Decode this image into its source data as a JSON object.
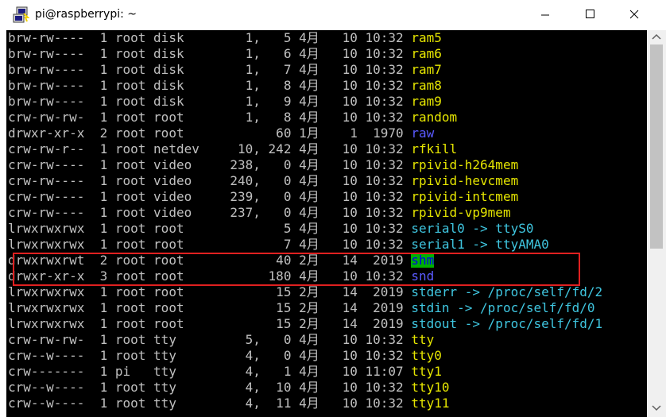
{
  "window": {
    "title": "pi@raspberrypi: ~",
    "icon": "putty-icon"
  },
  "controls": {
    "minimize_icon": "minimize-icon",
    "maximize_icon": "maximize-icon",
    "close_icon": "close-icon"
  },
  "colors": {
    "terminal_bg": "#000000",
    "text": "#c0c0c0",
    "device_name": "#e5e500",
    "symlink_name": "#3fc6e0",
    "dir_name": "#5a5aff",
    "highlight_box": "#e02020"
  },
  "scrollbar": {
    "position_fraction": 0.57
  },
  "listing": [
    {
      "perm": "brw-rw----",
      "links": " 1",
      "user": "root",
      "group": "disk  ",
      "size": "     1,   5",
      "date": "4月   10 10:32",
      "name": "ram5",
      "color": "yellow"
    },
    {
      "perm": "brw-rw----",
      "links": " 1",
      "user": "root",
      "group": "disk  ",
      "size": "     1,   6",
      "date": "4月   10 10:32",
      "name": "ram6",
      "color": "yellow"
    },
    {
      "perm": "brw-rw----",
      "links": " 1",
      "user": "root",
      "group": "disk  ",
      "size": "     1,   7",
      "date": "4月   10 10:32",
      "name": "ram7",
      "color": "yellow"
    },
    {
      "perm": "brw-rw----",
      "links": " 1",
      "user": "root",
      "group": "disk  ",
      "size": "     1,   8",
      "date": "4月   10 10:32",
      "name": "ram8",
      "color": "yellow"
    },
    {
      "perm": "brw-rw----",
      "links": " 1",
      "user": "root",
      "group": "disk  ",
      "size": "     1,   9",
      "date": "4月   10 10:32",
      "name": "ram9",
      "color": "yellow"
    },
    {
      "perm": "crw-rw-rw-",
      "links": " 1",
      "user": "root",
      "group": "root  ",
      "size": "     1,   8",
      "date": "4月   10 10:32",
      "name": "random",
      "color": "yellow"
    },
    {
      "perm": "drwxr-xr-x",
      "links": " 2",
      "user": "root",
      "group": "root  ",
      "size": "         60",
      "date": "1月    1  1970",
      "name": "raw",
      "color": "blue"
    },
    {
      "perm": "crw-rw-r--",
      "links": " 1",
      "user": "root",
      "group": "netdev",
      "size": "    10, 242",
      "date": "4月   10 10:32",
      "name": "rfkill",
      "color": "yellow"
    },
    {
      "perm": "crw-rw----",
      "links": " 1",
      "user": "root",
      "group": "video ",
      "size": "   238,   0",
      "date": "4月   10 10:32",
      "name": "rpivid-h264mem",
      "color": "yellow"
    },
    {
      "perm": "crw-rw----",
      "links": " 1",
      "user": "root",
      "group": "video ",
      "size": "   240,   0",
      "date": "4月   10 10:32",
      "name": "rpivid-hevcmem",
      "color": "yellow"
    },
    {
      "perm": "crw-rw----",
      "links": " 1",
      "user": "root",
      "group": "video ",
      "size": "   239,   0",
      "date": "4月   10 10:32",
      "name": "rpivid-intcmem",
      "color": "yellow"
    },
    {
      "perm": "crw-rw----",
      "links": " 1",
      "user": "root",
      "group": "video ",
      "size": "   237,   0",
      "date": "4月   10 10:32",
      "name": "rpivid-vp9mem",
      "color": "yellow"
    },
    {
      "perm": "lrwxrwxrwx",
      "links": " 1",
      "user": "root",
      "group": "root  ",
      "size": "          5",
      "date": "4月   10 10:32",
      "name": "serial0 -> ttyS0",
      "color": "cyan"
    },
    {
      "perm": "lrwxrwxrwx",
      "links": " 1",
      "user": "root",
      "group": "root  ",
      "size": "          7",
      "date": "4月   10 10:32",
      "name": "serial1 -> ttyAMA0",
      "color": "cyan"
    },
    {
      "perm": "drwxrwxrwt",
      "links": " 2",
      "user": "root",
      "group": "root  ",
      "size": "         40",
      "date": "2月   14  2019",
      "name": "shm",
      "color": "shm"
    },
    {
      "perm": "drwxr-xr-x",
      "links": " 3",
      "user": "root",
      "group": "root  ",
      "size": "        180",
      "date": "4月   10 10:32",
      "name": "snd",
      "color": "blue"
    },
    {
      "perm": "lrwxrwxrwx",
      "links": " 1",
      "user": "root",
      "group": "root  ",
      "size": "         15",
      "date": "2月   14  2019",
      "name": "stderr -> /proc/self/fd/2",
      "color": "cyan"
    },
    {
      "perm": "lrwxrwxrwx",
      "links": " 1",
      "user": "root",
      "group": "root  ",
      "size": "         15",
      "date": "2月   14  2019",
      "name": "stdin -> /proc/self/fd/0",
      "color": "cyan"
    },
    {
      "perm": "lrwxrwxrwx",
      "links": " 1",
      "user": "root",
      "group": "root  ",
      "size": "         15",
      "date": "2月   14  2019",
      "name": "stdout -> /proc/self/fd/1",
      "color": "cyan"
    },
    {
      "perm": "crw-rw-rw-",
      "links": " 1",
      "user": "root",
      "group": "tty   ",
      "size": "     5,   0",
      "date": "4月   10 10:32",
      "name": "tty",
      "color": "yellow"
    },
    {
      "perm": "crw--w----",
      "links": " 1",
      "user": "root",
      "group": "tty   ",
      "size": "     4,   0",
      "date": "4月   10 10:32",
      "name": "tty0",
      "color": "yellow"
    },
    {
      "perm": "crw-------",
      "links": " 1",
      "user": "pi  ",
      "group": "tty   ",
      "size": "     4,   1",
      "date": "4月   10 11:07",
      "name": "tty1",
      "color": "yellow"
    },
    {
      "perm": "crw--w----",
      "links": " 1",
      "user": "root",
      "group": "tty   ",
      "size": "     4,  10",
      "date": "4月   10 10:32",
      "name": "tty10",
      "color": "yellow"
    },
    {
      "perm": "crw--w----",
      "links": " 1",
      "user": "root",
      "group": "tty   ",
      "size": "     4,  11",
      "date": "4月   10 10:32",
      "name": "tty11",
      "color": "yellow"
    }
  ]
}
